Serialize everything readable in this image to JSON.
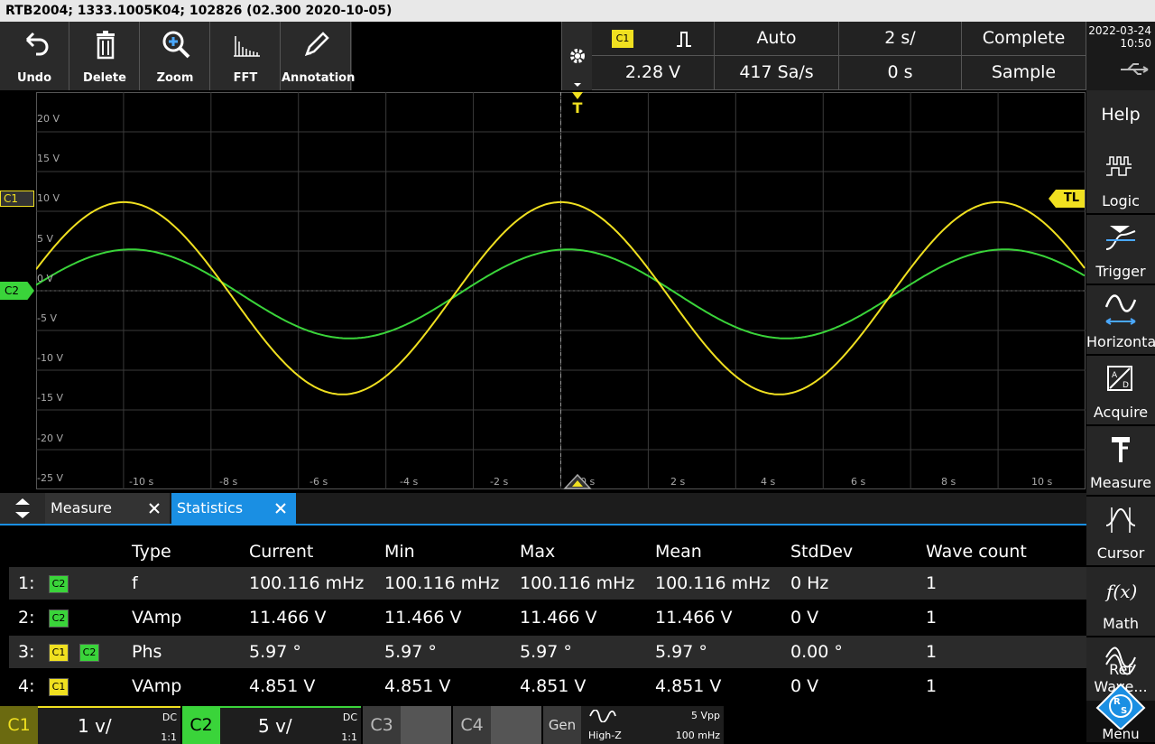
{
  "title": "RTB2004; 1333.1005K04; 102826 (02.300 2020-10-05)",
  "toolbar": {
    "undo": "Undo",
    "delete": "Delete",
    "zoom": "Zoom",
    "fft": "FFT",
    "annotation": "Annotation"
  },
  "header": {
    "channel": "C1",
    "level": "2.28 V",
    "mode": "Auto",
    "sample_rate": "417 Sa/s",
    "timebase": "2 s/",
    "offset": "0 s",
    "status": "Complete",
    "acq_mode": "Sample"
  },
  "datetime": {
    "date": "2022-03-24",
    "time": "10:50"
  },
  "sidebar": {
    "help": "Help",
    "logic": "Logic",
    "trigger": "Trigger",
    "horizontal": "Horizontal",
    "acquire": "Acquire",
    "measure": "Measure",
    "cursor": "Cursor",
    "math": "Math",
    "ref": "Ref Wave...",
    "menu": "Menu"
  },
  "plot": {
    "y_labels": [
      "20 V",
      "15 V",
      "10 V",
      "5 V",
      "0 V",
      "-5 V",
      "-10 V",
      "-15 V",
      "-20 V",
      "-25 V"
    ],
    "x_labels": [
      "-10 s",
      "-8 s",
      "-6 s",
      "-4 s",
      "-2 s",
      "0 s",
      "2 s",
      "4 s",
      "6 s",
      "8 s",
      "10 s"
    ],
    "c1_marker": "C1",
    "c2_marker": "C2",
    "trigger_marker": "T",
    "trigger_level_marker": "TL",
    "colors": {
      "c1": "#f0e020",
      "c2": "#3ad43a",
      "grid": "#3a3a3a"
    }
  },
  "tabs": {
    "measure": "Measure",
    "statistics": "Statistics"
  },
  "stats": {
    "headers": [
      "Type",
      "Current",
      "Min",
      "Max",
      "Mean",
      "StdDev",
      "Wave count"
    ],
    "rows": [
      {
        "idx": "1:",
        "sources": [
          "C2"
        ],
        "type": "f",
        "current": "100.116 mHz",
        "min": "100.116 mHz",
        "max": "100.116 mHz",
        "mean": "100.116 mHz",
        "std": "0 Hz",
        "count": "1"
      },
      {
        "idx": "2:",
        "sources": [
          "C2"
        ],
        "type": "VAmp",
        "current": "11.466 V",
        "min": "11.466 V",
        "max": "11.466 V",
        "mean": "11.466 V",
        "std": "0 V",
        "count": "1"
      },
      {
        "idx": "3:",
        "sources": [
          "C1",
          "C2"
        ],
        "type": "Phs",
        "current": "5.97 °",
        "min": "5.97 °",
        "max": "5.97 °",
        "mean": "5.97 °",
        "std": "0.00 °",
        "count": "1"
      },
      {
        "idx": "4:",
        "sources": [
          "C1"
        ],
        "type": "VAmp",
        "current": "4.851 V",
        "min": "4.851 V",
        "max": "4.851 V",
        "mean": "4.851 V",
        "std": "0 V",
        "count": "1"
      }
    ]
  },
  "bottom": {
    "c1": {
      "label": "C1",
      "scale": "1 v/",
      "coupling": "DC",
      "ratio": "1:1"
    },
    "c2": {
      "label": "C2",
      "scale": "5 v/",
      "coupling": "DC",
      "ratio": "1:1"
    },
    "c3": "C3",
    "c4": "C4",
    "gen": {
      "label": "Gen",
      "impedance": "High-Z",
      "amplitude": "5 Vpp",
      "frequency": "100 mHz"
    }
  }
}
